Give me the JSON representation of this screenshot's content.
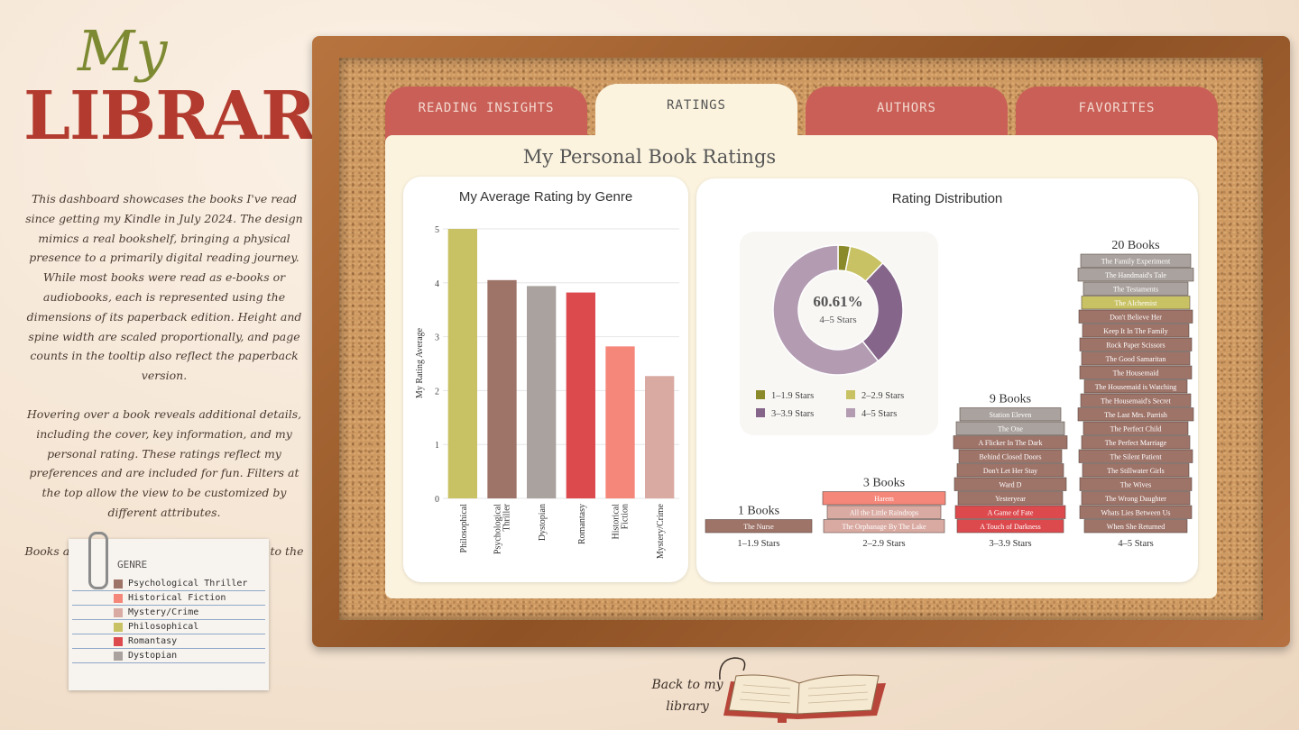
{
  "logo": {
    "line1": "My",
    "line2": "LIBRARY"
  },
  "intro": {
    "p1": "This dashboard showcases the books I've read since getting my Kindle in July 2024. The design mimics a real bookshelf, bringing a physical presence to a primarily digital reading journey. While most books were read as e-books or audiobooks, each is represented using the dimensions of its paperback edition. Height and spine width are scaled proportionally, and page counts in the tooltip also reflect the paperback version.",
    "p2": "Hovering over a book reveals additional details, including the cover, key information, and my personal rating. These ratings reflect my preferences and are included for fun. Filters at the top allow the view to be customized by different attributes.",
    "p3": "Books are color-coded by genre according to the legend below."
  },
  "legend": {
    "title": "GENRE",
    "items": [
      {
        "label": "Psychological Thriller",
        "color": "#9e7368"
      },
      {
        "label": "Historical Fiction",
        "color": "#f5877a"
      },
      {
        "label": "Mystery/Crime",
        "color": "#d9aaa2"
      },
      {
        "label": "Philosophical",
        "color": "#c8c264"
      },
      {
        "label": "Romantasy",
        "color": "#dc4a4e"
      },
      {
        "label": "Dystopian",
        "color": "#aaa29e"
      }
    ]
  },
  "back": {
    "label": "Back to my library"
  },
  "tabs": [
    "READING INSIGHTS",
    "RATINGS",
    "AUTHORS",
    "FAVORITES"
  ],
  "panel_title": "My Personal Book Ratings",
  "genre_chart": {
    "title": "My Average Rating by Genre"
  },
  "dist_chart": {
    "title": "Rating Distribution"
  },
  "donut": {
    "pct": "60.61%",
    "sub": "4–5 Stars"
  },
  "chart_data": [
    {
      "type": "bar",
      "title": "My Average Rating by Genre",
      "ylabel": "My Rating Average",
      "ylim": [
        0,
        5
      ],
      "yticks": [
        0,
        1,
        2,
        3,
        4,
        5
      ],
      "categories": [
        "Philosophical",
        "Psychological Thriller",
        "Dystopian",
        "Romantasy",
        "Historical Fiction",
        "Mystery/Crime"
      ],
      "values": [
        5.0,
        4.05,
        3.94,
        3.82,
        2.82,
        2.27
      ],
      "colors": [
        "#c8c264",
        "#9e7368",
        "#aaa29e",
        "#dc4a4e",
        "#f5877a",
        "#d9aaa2"
      ]
    },
    {
      "type": "pie",
      "title": "Rating Distribution",
      "labels": [
        "1–1.9 Stars",
        "2–2.9 Stars",
        "3–3.9 Stars",
        "4–5 Stars"
      ],
      "values": [
        1,
        3,
        9,
        20
      ],
      "colors": [
        "#8a8a2a",
        "#c8c264",
        "#85668a",
        "#b39cb2"
      ]
    },
    {
      "type": "bar",
      "title": "Rating Distribution",
      "groups": [
        {
          "label": "1–1.9 Stars",
          "count_label": "1 Books",
          "books": [
            {
              "title": "The Nurse",
              "color": "#9e7368"
            }
          ]
        },
        {
          "label": "2–2.9 Stars",
          "count_label": "3 Books",
          "books": [
            {
              "title": "Harem",
              "color": "#f5877a"
            },
            {
              "title": "All the Little Raindrops",
              "color": "#d9aaa2"
            },
            {
              "title": "The Orphanage By The Lake",
              "color": "#d9aaa2"
            }
          ]
        },
        {
          "label": "3–3.9 Stars",
          "count_label": "9 Books",
          "books": [
            {
              "title": "Station Eleven",
              "color": "#aaa29e"
            },
            {
              "title": "The One",
              "color": "#aaa29e"
            },
            {
              "title": "A Flicker In The Dark",
              "color": "#9e7368"
            },
            {
              "title": "Behind Closed Doors",
              "color": "#9e7368"
            },
            {
              "title": "Don't Let Her Stay",
              "color": "#9e7368"
            },
            {
              "title": "Ward D",
              "color": "#9e7368"
            },
            {
              "title": "Yesteryear",
              "color": "#9e7368"
            },
            {
              "title": "A Game of Fate",
              "color": "#dc4a4e"
            },
            {
              "title": "A Touch of Darkness",
              "color": "#dc4a4e"
            }
          ]
        },
        {
          "label": "4–5 Stars",
          "count_label": "20 Books",
          "books": [
            {
              "title": "The Family Experiment",
              "color": "#aaa29e"
            },
            {
              "title": "The Handmaid's Tale",
              "color": "#aaa29e"
            },
            {
              "title": "The Testaments",
              "color": "#aaa29e"
            },
            {
              "title": "The Alchemist",
              "color": "#c8c264"
            },
            {
              "title": "Don't Believe Her",
              "color": "#9e7368"
            },
            {
              "title": "Keep It In The Family",
              "color": "#9e7368"
            },
            {
              "title": "Rock Paper Scissors",
              "color": "#9e7368"
            },
            {
              "title": "The Good Samaritan",
              "color": "#9e7368"
            },
            {
              "title": "The Housemaid",
              "color": "#9e7368"
            },
            {
              "title": "The Housemaid is Watching",
              "color": "#9e7368"
            },
            {
              "title": "The Housemaid's Secret",
              "color": "#9e7368"
            },
            {
              "title": "The Last Mrs. Parrish",
              "color": "#9e7368"
            },
            {
              "title": "The Perfect Child",
              "color": "#9e7368"
            },
            {
              "title": "The Perfect Marriage",
              "color": "#9e7368"
            },
            {
              "title": "The Silent Patient",
              "color": "#9e7368"
            },
            {
              "title": "The Stillwater Girls",
              "color": "#9e7368"
            },
            {
              "title": "The Wives",
              "color": "#9e7368"
            },
            {
              "title": "The Wrong Daughter",
              "color": "#9e7368"
            },
            {
              "title": "Whats Lies Between Us",
              "color": "#9e7368"
            },
            {
              "title": "When She Returned",
              "color": "#9e7368"
            }
          ]
        }
      ]
    }
  ]
}
